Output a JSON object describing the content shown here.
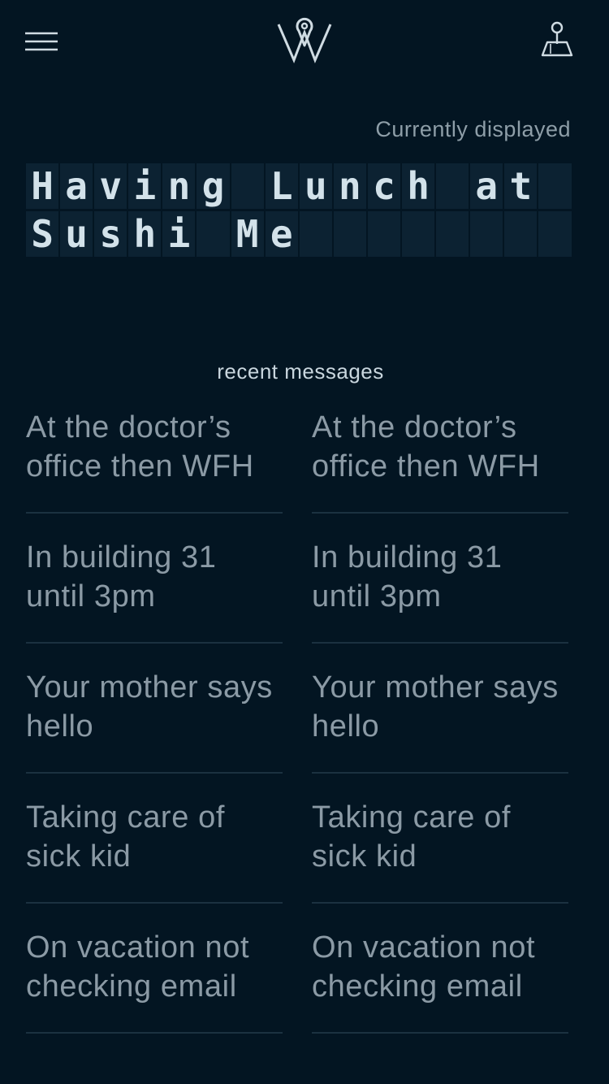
{
  "header": {
    "menu_icon": "hamburger-menu-icon",
    "logo_icon": "location-pin-w-logo",
    "board_icon": "board-pin-icon"
  },
  "current": {
    "label": "Currently displayed",
    "rows": [
      [
        "H",
        "a",
        "v",
        "i",
        "n",
        "g",
        " ",
        "L",
        "u",
        "n",
        "c",
        "h",
        " ",
        "a",
        "t",
        ""
      ],
      [
        "S",
        "u",
        "s",
        "h",
        "i",
        " ",
        "M",
        "e",
        "",
        "",
        "",
        "",
        "",
        "",
        "",
        ""
      ]
    ]
  },
  "recent": {
    "title": "recent messages",
    "messages": [
      [
        "At the doctor’s\noffice then WFH",
        "At the doctor’s\noffice then WFH"
      ],
      [
        "In building 31\nuntil 3pm",
        "In building 31\nuntil 3pm"
      ],
      [
        "Your mother says\nhello",
        "Your mother says\nhello"
      ],
      [
        "Taking care of\nsick kid",
        "Taking care of\nsick kid"
      ],
      [
        "On vacation not\nchecking email",
        "On vacation not\nchecking email"
      ]
    ]
  },
  "colors": {
    "background": "#031522",
    "cell": "#0c2232",
    "text_bright": "#d3e2ea",
    "text_muted": "#8b9aa5",
    "divider": "#1b3140"
  }
}
